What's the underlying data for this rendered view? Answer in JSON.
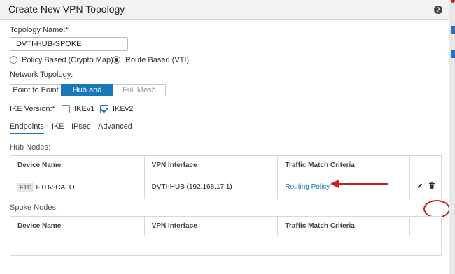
{
  "dialog": {
    "title": "Create New VPN Topology",
    "help_icon_label": "?"
  },
  "topology_name": {
    "label": "Topology Name:*",
    "value": "DVTI-HUB-SPOKE"
  },
  "vpn_type": {
    "options": [
      "Policy Based (Crypto Map)",
      "Route Based (VTI)"
    ],
    "selected": "Route Based (VTI)"
  },
  "network_topology": {
    "label": "Network Topology:",
    "options": [
      "Point to Point",
      "Hub and Spoke",
      "Full Mesh"
    ],
    "selected": "Hub and Spoke"
  },
  "ike_version": {
    "label": "IKE Version:*",
    "ikev1_label": "IKEv1",
    "ikev1_checked": false,
    "ikev2_label": "IKEv2",
    "ikev2_checked": true
  },
  "tabs": [
    "Endpoints",
    "IKE",
    "IPsec",
    "Advanced"
  ],
  "active_tab": "Endpoints",
  "hub_nodes": {
    "label": "Hub Nodes:",
    "columns": [
      "Device Name",
      "VPN Interface",
      "Traffic Match Criteria"
    ],
    "rows": [
      {
        "badge": "FTD",
        "device": "FTDv-CALO",
        "interface": "DVTI-HUB (192.168.17.1)",
        "criteria": "Routing Policy"
      }
    ]
  },
  "spoke_nodes": {
    "label": "Spoke Nodes:",
    "columns": [
      "Device Name",
      "VPN Interface",
      "Traffic Match Criteria"
    ],
    "rows": []
  },
  "colors": {
    "accent": "#1678b9",
    "annotation_red": "#cc2020"
  }
}
